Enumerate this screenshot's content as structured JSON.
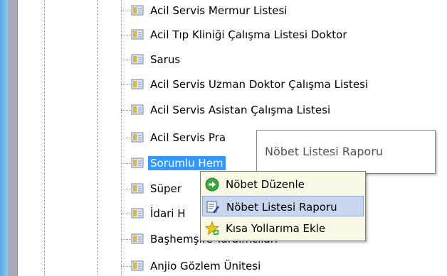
{
  "tree": {
    "items": [
      {
        "label": "Acil Servis Mermur Listesi"
      },
      {
        "label": "Acil Tıp Kliniği Çalışma Listesi Doktor"
      },
      {
        "label": "Sarus"
      },
      {
        "label": "Acil Servis Uzman Doktor Çalışma Listesi"
      },
      {
        "label": "Acil Servis Asistan Çalışma Listesi"
      },
      {
        "label": "Acil Servis Pra"
      },
      {
        "label": "Sorumlu Hem"
      },
      {
        "label": "Süper"
      },
      {
        "label": "İdari H"
      },
      {
        "label": "Başhemşire Yardımcıları"
      },
      {
        "label": "Anjio Gözlem Ünitesi"
      }
    ],
    "selected": "Sorumlu Hem"
  },
  "tooltip": {
    "text": "Nöbet Listesi Raporu"
  },
  "context_menu": {
    "items": [
      {
        "label": "Nöbet Düzenle",
        "icon": "green-arrow-icon"
      },
      {
        "label": "Nöbet Listesi Raporu",
        "icon": "report-icon"
      },
      {
        "label": "Kısa Yollarıma Ekle",
        "icon": "star-add-icon"
      }
    ],
    "highlighted": "Nöbet Listesi Raporu"
  },
  "colors": {
    "selection": "#3399ff",
    "menu_bg": "#fbf9e6",
    "menu_highlight": "#c8d6ee"
  }
}
